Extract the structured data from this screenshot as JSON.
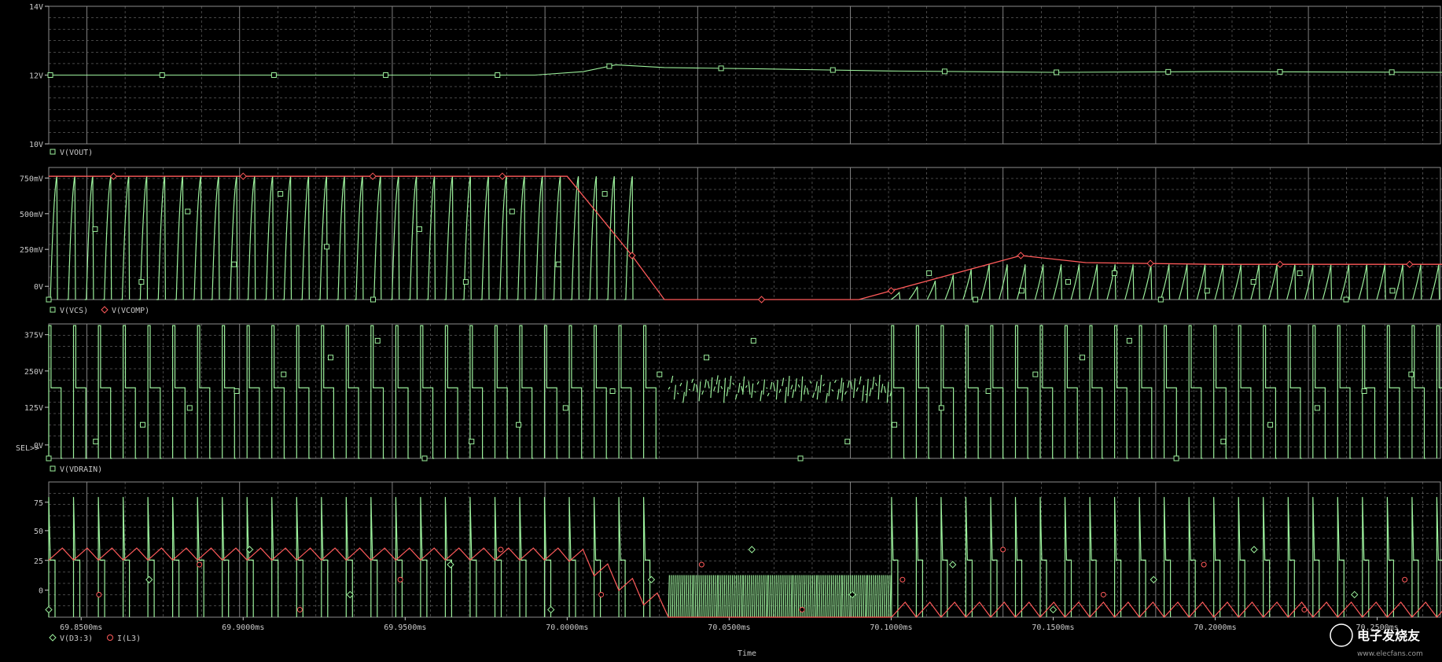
{
  "colors": {
    "background": "#000000",
    "grid": "#8c8c8c",
    "green": "#9cf09c",
    "red": "#ff5a5a",
    "text": "#c8c8c8"
  },
  "watermark": {
    "text": "电子发烧友",
    "url": "www.elecfans.com"
  },
  "chart_data": [
    {
      "type": "line",
      "ylim": [
        10,
        14
      ],
      "yticks": [
        "14V",
        "12V",
        "10V"
      ],
      "legend": [
        {
          "marker": "square",
          "label": "V(VOUT)"
        }
      ],
      "series": [
        {
          "name": "V(VOUT)",
          "color": "#9cf09c",
          "points": [
            [
              69.84,
              12.0
            ],
            [
              69.99,
              12.0
            ],
            [
              70.005,
              12.1
            ],
            [
              70.015,
              12.3
            ],
            [
              70.03,
              12.22
            ],
            [
              70.06,
              12.18
            ],
            [
              70.1,
              12.12
            ],
            [
              70.15,
              12.08
            ],
            [
              70.2,
              12.1
            ],
            [
              70.27,
              12.08
            ]
          ]
        }
      ]
    },
    {
      "type": "line",
      "ylim": [
        0,
        750
      ],
      "yticks": [
        "750mV",
        "500mV",
        "250mV",
        "0V"
      ],
      "legend": [
        {
          "marker": "square",
          "label": "V(VCS)"
        },
        {
          "marker": "diamond",
          "label": "V(VCOMP)"
        }
      ],
      "series": [
        {
          "name": "V(VCS)",
          "color": "#9cf09c",
          "pulse_train": {
            "period_ms": 0.0055,
            "peak": 700,
            "from_ms": 69.84,
            "to_ms": 70.017,
            "amplitude_note": "sawtooth pulses"
          }
        },
        {
          "name": "V(VCOMP)",
          "color": "#ff5a5a",
          "points": [
            [
              69.84,
              700
            ],
            [
              70.0,
              700
            ],
            [
              70.02,
              250
            ],
            [
              70.03,
              0
            ],
            [
              70.08,
              0
            ],
            [
              70.09,
              0
            ],
            [
              70.14,
              250
            ],
            [
              70.16,
              210
            ],
            [
              70.2,
              200
            ],
            [
              70.27,
              200
            ]
          ]
        }
      ]
    },
    {
      "type": "line",
      "ylim": [
        0,
        400
      ],
      "yticks": [
        "375V",
        "250V",
        "125V",
        "0V"
      ],
      "left_note": "SEL>>",
      "legend": [
        {
          "marker": "square",
          "label": "V(VDRAIN)"
        }
      ],
      "series": [
        {
          "name": "V(VDRAIN)",
          "color": "#9cf09c",
          "switching_ms": [
            69.84,
            70.27
          ],
          "high": 395,
          "plateau": 210,
          "chatter_ms": [
            70.03,
            70.1
          ]
        }
      ]
    },
    {
      "type": "line",
      "ylim": [
        0,
        90
      ],
      "yticks": [
        "75",
        "50",
        "25",
        "0"
      ],
      "xlabel": "Time",
      "xticks": [
        "69.8500ms",
        "69.9000ms",
        "69.9500ms",
        "70.0000ms",
        "70.0500ms",
        "70.1000ms",
        "70.1500ms",
        "70.2000ms",
        "70.2500ms"
      ],
      "xtick_values": [
        69.85,
        69.9,
        69.95,
        70.0,
        70.05,
        70.1,
        70.15,
        70.2,
        70.25
      ],
      "xlim": [
        69.84,
        70.27
      ],
      "legend": [
        {
          "marker": "diamond",
          "label": "V(D3:3)"
        },
        {
          "marker": "circle",
          "label": "I(L3)"
        }
      ],
      "series": [
        {
          "name": "V(D3:3)",
          "color": "#9cf09c",
          "spikes": {
            "peak": 80,
            "baseline": 38
          }
        },
        {
          "name": "I(L3)",
          "color": "#ff5a5a",
          "points": [
            [
              69.84,
              40
            ],
            [
              70.0,
              40
            ],
            [
              70.03,
              0
            ],
            [
              70.1,
              0
            ],
            [
              70.12,
              8
            ],
            [
              70.27,
              8
            ]
          ]
        }
      ]
    }
  ]
}
